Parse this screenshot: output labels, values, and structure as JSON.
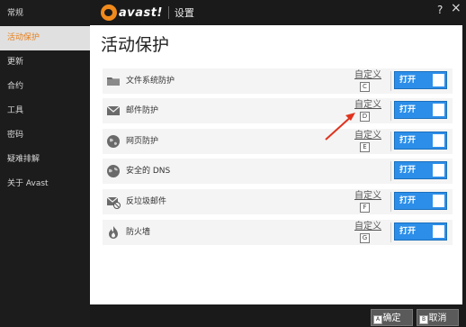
{
  "sidebar": {
    "items": [
      {
        "label": "常规",
        "active": false
      },
      {
        "label": "活动保护",
        "active": true
      },
      {
        "label": "更新",
        "active": false
      },
      {
        "label": "合约",
        "active": false
      },
      {
        "label": "工具",
        "active": false
      },
      {
        "label": "密码",
        "active": false
      },
      {
        "label": "疑难排解",
        "active": false
      },
      {
        "label": "关于 Avast",
        "active": false
      }
    ]
  },
  "header": {
    "logo_text": "avast!",
    "title": "设置",
    "help_label": "?",
    "close_label": "×"
  },
  "main": {
    "page_title": "活动保护",
    "shields": [
      {
        "label": "文件系统防护",
        "icon": "folder-icon",
        "custom_label": "自定义",
        "hotkey": "C",
        "toggle_label": "打开",
        "enabled": true
      },
      {
        "label": "邮件防护",
        "icon": "mail-icon",
        "custom_label": "自定义",
        "hotkey": "D",
        "toggle_label": "打开",
        "enabled": true
      },
      {
        "label": "网页防护",
        "icon": "globe-icon",
        "custom_label": "自定义",
        "hotkey": "E",
        "toggle_label": "打开",
        "enabled": true
      },
      {
        "label": "安全的 DNS",
        "icon": "dns-globe-icon",
        "custom_label": "",
        "hotkey": "",
        "toggle_label": "打开",
        "enabled": true
      },
      {
        "label": "反垃圾邮件",
        "icon": "antispam-mail-icon",
        "custom_label": "自定义",
        "hotkey": "F",
        "toggle_label": "打开",
        "enabled": true
      },
      {
        "label": "防火墙",
        "icon": "flame-icon",
        "custom_label": "自定义",
        "hotkey": "G",
        "toggle_label": "打开",
        "enabled": true
      }
    ]
  },
  "footer": {
    "ok_label": "确定",
    "ok_hotkey": "A",
    "cancel_label": "取消",
    "cancel_hotkey": "B"
  },
  "colors": {
    "accent": "#e8801c",
    "toggle_on": "#2c8ee8",
    "annotation_arrow": "#e0331e"
  }
}
